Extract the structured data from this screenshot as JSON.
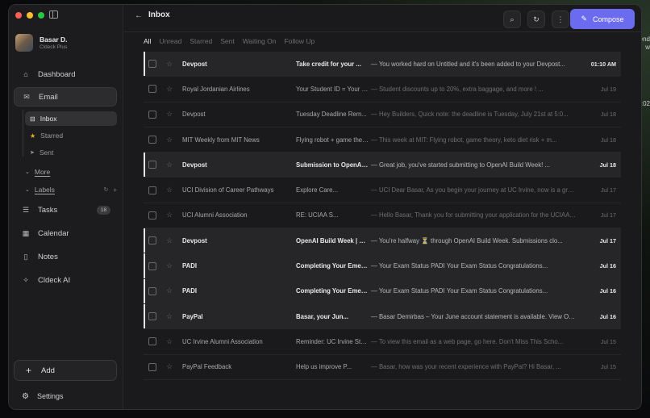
{
  "profile": {
    "name": "Basar D.",
    "plan": "Cldeck Plus"
  },
  "nav": {
    "dashboard": "Dashboard",
    "email": "Email",
    "inbox": "Inbox",
    "starred": "Starred",
    "sent": "Sent",
    "more": "More",
    "labels": "Labels",
    "tasks": "Tasks",
    "tasks_count": "18",
    "calendar": "Calendar",
    "notes": "Notes",
    "ai": "Cldeck AI",
    "add": "Add",
    "settings": "Settings"
  },
  "header": {
    "title": "Inbox",
    "compose": "Compose"
  },
  "tabs": [
    "All",
    "Unread",
    "Starred",
    "Sent",
    "Waiting On",
    "Follow Up"
  ],
  "emails": [
    {
      "sender": "Devpost",
      "subject": "Take credit for your ...",
      "snippet": "— You worked hard on Untitled and it's been added to your Devpost...",
      "date": "01:10 AM",
      "unread": true
    },
    {
      "sender": "Royal Jordanian Airlines",
      "subject": "Your Student ID = Your Board...",
      "snippet": "— Student discounts up to 20%, extra baggage, and more ! ...",
      "date": "Jul 19",
      "unread": false
    },
    {
      "sender": "Devpost",
      "subject": "Tuesday Deadline Rem...",
      "snippet": "— Hey Builders, Quick note: the deadline is Tuesday, July 21st at 5:0...",
      "date": "Jul 18",
      "unread": false
    },
    {
      "sender": "MIT Weekly from MIT News",
      "subject": "Flying robot + game theo...",
      "snippet": "— This week at MIT: Flying robot, game theory, keto diet risk + m...",
      "date": "Jul 18",
      "unread": false
    },
    {
      "sender": "Devpost",
      "subject": "Submission to OpenAI Bu...",
      "snippet": "— Great job, you've started submitting to OpenAI Build Week! ...",
      "date": "Jul 18",
      "unread": true
    },
    {
      "sender": "UCI Division of Career Pathways",
      "subject": "Explore Care...",
      "snippet": "— UCI Dear Basar, As you begin your journey at UC Irvine, now is a great time...",
      "date": "Jul 17",
      "unread": false
    },
    {
      "sender": "UCI Alumni Association",
      "subject": "RE: UCIAA S...",
      "snippet": "— Hello Basar, Thank you for submitting your application for the UCIAA Endow...",
      "date": "Jul 17",
      "unread": false
    },
    {
      "sender": "Devpost",
      "subject": "OpenAI Build Week | Hal...",
      "snippet": "— You're halfway ⏳ through OpenAI Build Week. Submissions clo...",
      "date": "Jul 17",
      "unread": true
    },
    {
      "sender": "PADI",
      "subject": "Completing Your Emergency ...",
      "snippet": "— Your Exam Status PADI Your Exam Status Congratulations...",
      "date": "Jul 16",
      "unread": true
    },
    {
      "sender": "PADI",
      "subject": "Completing Your Emergency ...",
      "snippet": "— Your Exam Status PADI Your Exam Status Congratulations...",
      "date": "Jul 16",
      "unread": true
    },
    {
      "sender": "PayPal",
      "subject": "Basar, your Jun...",
      "snippet": "— Basar Demirbas – Your June account statement is available. View Onlin...",
      "date": "Jul 16",
      "unread": true
    },
    {
      "sender": "UC Irvine Alumni Association",
      "subject": "Reminder: UC Irvine Stud...",
      "snippet": "— To view this email as a web page, go here. Don't Miss This Scho...",
      "date": "Jul 15",
      "unread": false
    },
    {
      "sender": "PayPal Feedback",
      "subject": "Help us improve P...",
      "snippet": "— Basar, how was your recent experience with PayPal? Hi Basar, ...",
      "date": "Jul 15",
      "unread": false
    }
  ],
  "colors": {
    "accent": "#6b6bf0",
    "background": "#1a1a1c",
    "unread_row": "#262628"
  },
  "edge_text": [
    "end",
    "w",
    ":02"
  ]
}
